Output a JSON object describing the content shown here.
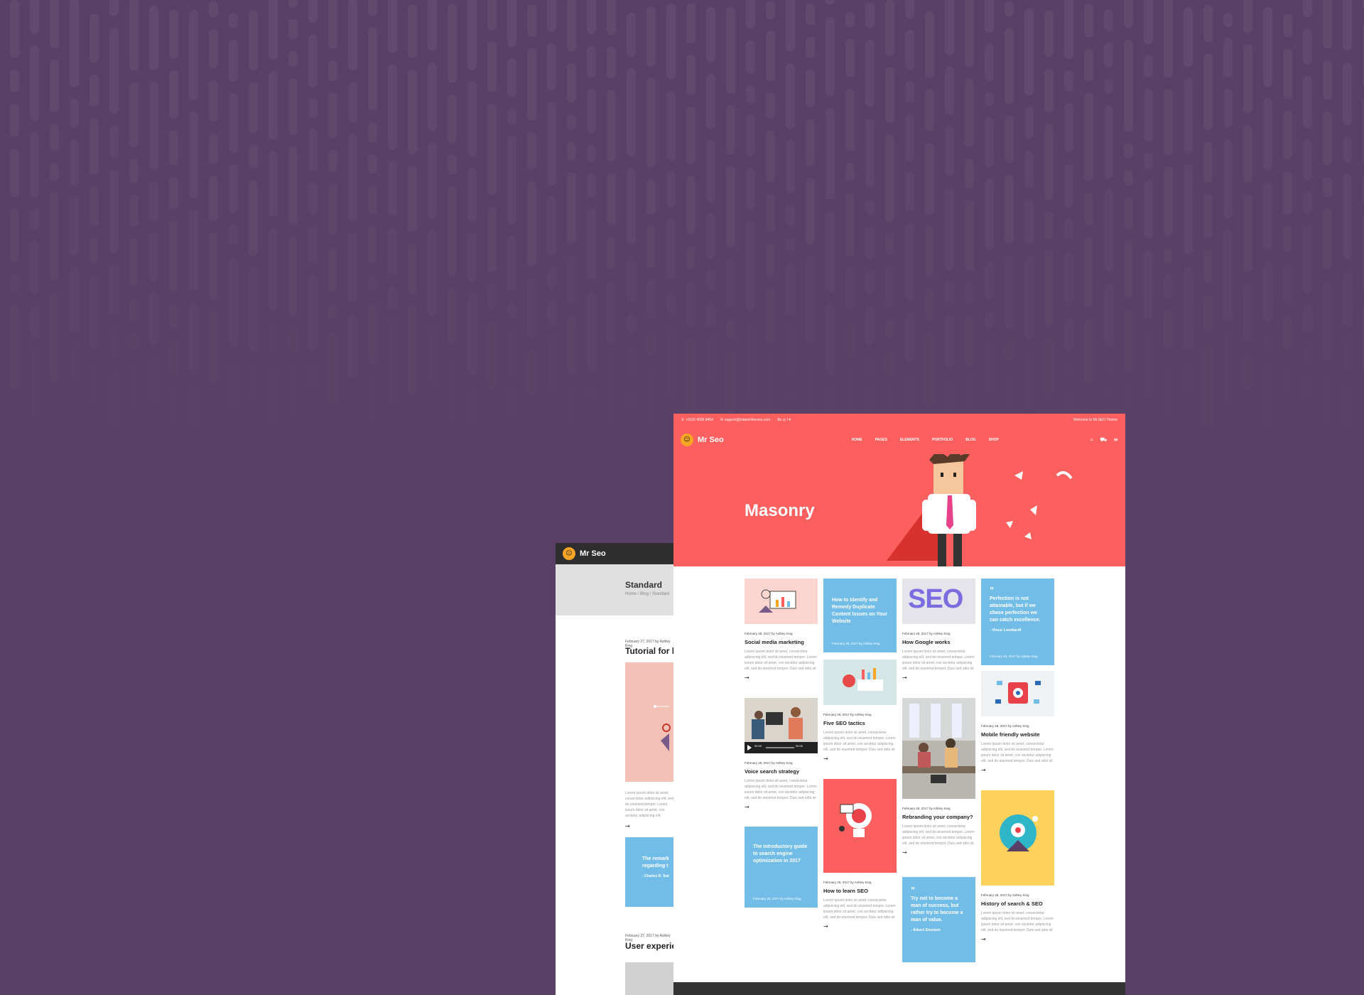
{
  "colors": {
    "background": "#5a4066",
    "accent": "#fb5f5e",
    "quote": "#72bde8",
    "dark": "#2e2e2e"
  },
  "back_page": {
    "brand": "Mr Seo",
    "title": "Standard",
    "breadcrumb": "Home  /  Blog  /  Standard",
    "post1_meta": "February 27, 2017 by Ashley King",
    "post1_title": "Tutorial for b",
    "post1_excerpt": "Lorem ipsum dolor sit amet, consectetur adipiscing elit, sed do eiusmod tempor. Lorem ipsum dolor sit amet, con sectetur adipiscing elit.",
    "quote": "The remark regarding t",
    "quote_author": "- Charles R. Swi",
    "post2_meta": "February 27, 2017 by Ashley King",
    "post2_title": "User experie"
  },
  "topbar": {
    "phone": "+0116 4095 8454",
    "email": "support@elated-themes.com",
    "social": "Be  ◎  f  ♥",
    "welcome": "Welcome to Mr.SEO Theme"
  },
  "nav": {
    "brand": "Mr Seo",
    "items": [
      "HOME",
      "PAGES",
      "ELEMENTS",
      "PORTFOLIO",
      "BLOG",
      "SHOP"
    ],
    "search_icon": "⌕",
    "cart_icon": "🛒",
    "menu_icon": "≡"
  },
  "hero": {
    "title": "Masonry"
  },
  "meta": "February 28, 2017 by Ashley King",
  "excerpt": "Lorem ipsum dolor sit amet, consectetur adipiscing elit, sed do eiusmod tempor. Lorem ipsum dolor sit amet, con sectetur adipiscing elit, sed do eiusmod tempor. Duis sed odio sit amet nibh.",
  "arrow": "→",
  "posts": {
    "social": "Social media marketing",
    "voice": "Voice search strategy",
    "five": "Five SEO tactics",
    "learn": "How to learn SEO",
    "google": "How Google works",
    "rebrand": "Rebranding your company?",
    "mobile": "Mobile friendly website",
    "history": "History of search & SEO"
  },
  "blue_cards": {
    "duplicate": "How to Identify and Remedy Duplicate Content Issues on Your Website",
    "intro": "The introductory guide to search engine optimization in 2017",
    "quote1": "Perfection is not attainable, but if we chase perfection we can catch excellence.",
    "quote1_author": "- Vince Lombardi",
    "quote2": "Try not to become a man of success, but rather try to become a man of value.",
    "quote2_author": "- Albert Einstein"
  },
  "video": {
    "time": "00:00",
    "end": "00:00"
  },
  "seo_image_text": "SEO"
}
